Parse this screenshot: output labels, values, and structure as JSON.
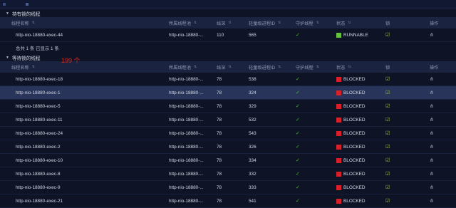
{
  "held_section": {
    "title": "持有锁的线程",
    "columns": [
      "线程名称",
      "所属线程池",
      "线深",
      "轻量级进程ID",
      "守护线程",
      "状态",
      "锁",
      "操作"
    ],
    "rows": [
      {
        "name": "http-nio-18880-exec-44",
        "pool": "http-nio-18880-...",
        "depth": "110",
        "lwp": "565",
        "status": "RUNNABLE"
      }
    ],
    "footer": "总共 1 条  已显示 1 条"
  },
  "waiting_section": {
    "title": "等待锁的线程",
    "count": "199 个",
    "columns": [
      "线程名称",
      "所属线程池",
      "线深",
      "轻量级进程ID",
      "守护线程",
      "状态",
      "锁",
      "操作"
    ],
    "rows": [
      {
        "name": "http-nio-18880-exec-18",
        "pool": "http-nio-18880-...",
        "depth": "78",
        "lwp": "538",
        "status": "BLOCKED"
      },
      {
        "name": "http-nio-18880-exec-1",
        "pool": "http-nio-18880-...",
        "depth": "78",
        "lwp": "324",
        "status": "BLOCKED"
      },
      {
        "name": "http-nio-18880-exec-5",
        "pool": "http-nio-18880-...",
        "depth": "78",
        "lwp": "329",
        "status": "BLOCKED"
      },
      {
        "name": "http-nio-18880-exec-11",
        "pool": "http-nio-18880-...",
        "depth": "78",
        "lwp": "532",
        "status": "BLOCKED"
      },
      {
        "name": "http-nio-18880-exec-24",
        "pool": "http-nio-18880-...",
        "depth": "78",
        "lwp": "543",
        "status": "BLOCKED"
      },
      {
        "name": "http-nio-18880-exec-2",
        "pool": "http-nio-18880-...",
        "depth": "78",
        "lwp": "326",
        "status": "BLOCKED"
      },
      {
        "name": "http-nio-18880-exec-10",
        "pool": "http-nio-18880-...",
        "depth": "78",
        "lwp": "334",
        "status": "BLOCKED"
      },
      {
        "name": "http-nio-18880-exec-8",
        "pool": "http-nio-18880-...",
        "depth": "78",
        "lwp": "332",
        "status": "BLOCKED"
      },
      {
        "name": "http-nio-18880-exec-9",
        "pool": "http-nio-18880-...",
        "depth": "78",
        "lwp": "333",
        "status": "BLOCKED"
      },
      {
        "name": "http-nio-18880-exec-21",
        "pool": "http-nio-18880-...",
        "depth": "78",
        "lwp": "541",
        "status": "BLOCKED"
      }
    ]
  },
  "colors": {
    "runnable": "#62c23d",
    "blocked": "#d81f2a",
    "count_text": "#e0261f"
  }
}
